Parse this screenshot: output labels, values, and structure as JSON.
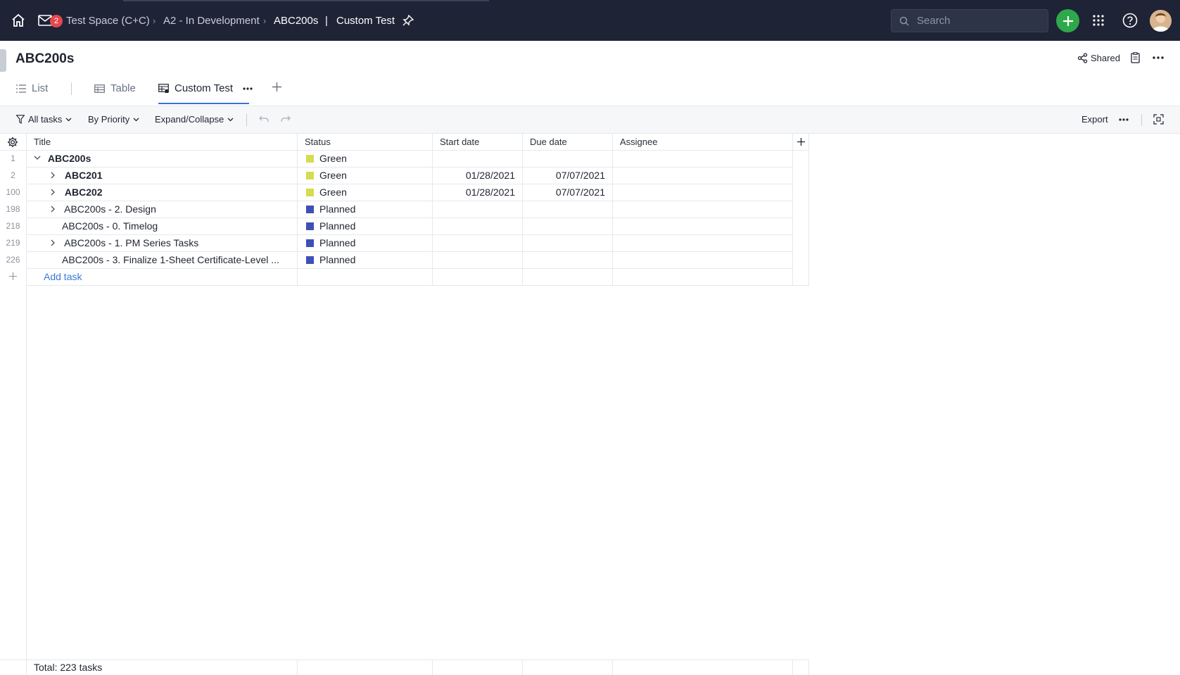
{
  "topbar": {
    "notification_count": "2",
    "breadcrumbs": [
      "Test Space (C+C)",
      "A2 - In Development",
      "ABC200s"
    ],
    "current_view": "Custom Test",
    "search_placeholder": "Search"
  },
  "header": {
    "title": "ABC200s",
    "shared_label": "Shared"
  },
  "tabs": [
    {
      "label": "List"
    },
    {
      "label": "Table"
    },
    {
      "label": "Custom Test"
    }
  ],
  "toolbar": {
    "filter_label": "All tasks",
    "group_label": "By Priority",
    "expand_label": "Expand/Collapse",
    "export_label": "Export"
  },
  "table": {
    "columns": [
      "Title",
      "Status",
      "Start date",
      "Due date",
      "Assignee"
    ],
    "rows": [
      {
        "num": "1",
        "title": "ABC200s",
        "status": "Green",
        "start": "",
        "due": "",
        "assignee": ""
      },
      {
        "num": "2",
        "title": "ABC201",
        "status": "Green",
        "start": "01/28/2021",
        "due": "07/07/2021",
        "assignee": ""
      },
      {
        "num": "100",
        "title": "ABC202",
        "status": "Green",
        "start": "01/28/2021",
        "due": "07/07/2021",
        "assignee": ""
      },
      {
        "num": "198",
        "title": "ABC200s - 2. Design",
        "status": "Planned",
        "start": "",
        "due": "",
        "assignee": ""
      },
      {
        "num": "218",
        "title": "ABC200s - 0. Timelog",
        "status": "Planned",
        "start": "",
        "due": "",
        "assignee": ""
      },
      {
        "num": "219",
        "title": "ABC200s - 1. PM Series Tasks",
        "status": "Planned",
        "start": "",
        "due": "",
        "assignee": ""
      },
      {
        "num": "226",
        "title": "ABC200s - 3. Finalize 1-Sheet Certificate-Level ...",
        "status": "Planned",
        "start": "",
        "due": "",
        "assignee": ""
      }
    ],
    "add_task_label": "Add task",
    "total_label": "Total: 223 tasks"
  },
  "colors": {
    "green_status": "#d4dc4f",
    "planned_status": "#3f4fb8",
    "accent": "#3b6fd8",
    "topbar_bg": "#1e2336",
    "add_button": "#2ea84a"
  }
}
